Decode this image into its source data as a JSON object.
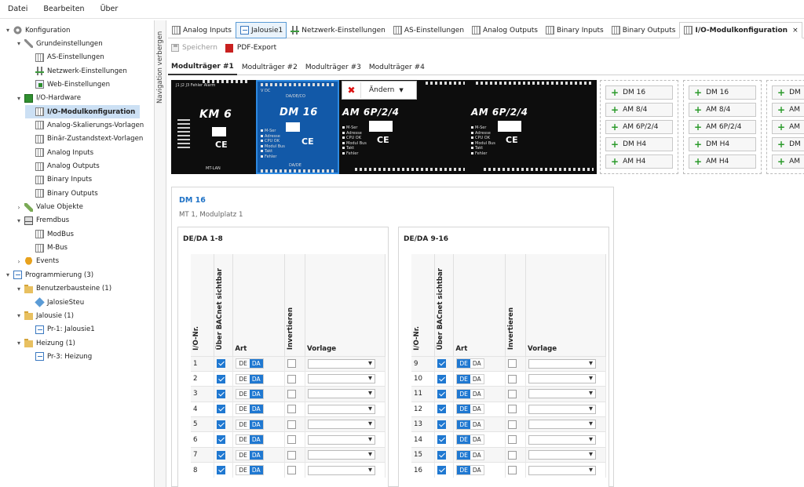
{
  "menu": [
    "Datei",
    "Bearbeiten",
    "Über"
  ],
  "tree": [
    {
      "label": "Konfiguration",
      "icon": "gear-icon",
      "chev": "▾"
    },
    {
      "label": "Grundeinstellungen",
      "icon": "wrench-icon",
      "chev": "▾"
    },
    {
      "label": "AS-Einstellungen",
      "icon": "grid-icon",
      "chev": ""
    },
    {
      "label": "Netzwerk-Einstellungen",
      "icon": "network-icon",
      "chev": ""
    },
    {
      "label": "Web-Einstellungen",
      "icon": "web-icon",
      "chev": ""
    },
    {
      "label": "I/O-Hardware",
      "icon": "hardware-icon",
      "chev": "▾"
    },
    {
      "label": "I/O-Modulkonfiguration",
      "icon": "grid-icon",
      "chev": ""
    },
    {
      "label": "Analog-Skalierungs-Vorlagen",
      "icon": "grid-icon",
      "chev": ""
    },
    {
      "label": "Binär-Zustandstext-Vorlagen",
      "icon": "grid-icon",
      "chev": ""
    },
    {
      "label": "Analog Inputs",
      "icon": "grid-icon",
      "chev": ""
    },
    {
      "label": "Analog Outputs",
      "icon": "grid-icon",
      "chev": ""
    },
    {
      "label": "Binary Inputs",
      "icon": "grid-icon",
      "chev": ""
    },
    {
      "label": "Binary Outputs",
      "icon": "grid-icon",
      "chev": ""
    },
    {
      "label": "Value Objekte",
      "icon": "value-icon",
      "chev": "›"
    },
    {
      "label": "Fremdbus",
      "icon": "bus-icon",
      "chev": "▾"
    },
    {
      "label": "ModBus",
      "icon": "grid-icon",
      "chev": ""
    },
    {
      "label": "M-Bus",
      "icon": "grid-icon",
      "chev": ""
    },
    {
      "label": "Events",
      "icon": "bell-icon",
      "chev": "›"
    },
    {
      "label": "Programmierung (3)",
      "icon": "program-icon",
      "chev": "▾"
    },
    {
      "label": "Benutzerbausteine (1)",
      "icon": "folder-icon",
      "chev": "▾"
    },
    {
      "label": "JalosieSteu",
      "icon": "cube-icon",
      "chev": ""
    },
    {
      "label": "Jalousie (1)",
      "icon": "folder-icon",
      "chev": "▾"
    },
    {
      "label": "Pr-1: Jalousie1",
      "icon": "program-icon",
      "chev": ""
    },
    {
      "label": "Heizung (1)",
      "icon": "folder-icon",
      "chev": "▾"
    },
    {
      "label": "Pr-3: Heizung",
      "icon": "program-icon",
      "chev": ""
    }
  ],
  "nav_toggle": "Navigation verbergen",
  "tabs": [
    "Analog Inputs",
    "Jalousie1",
    "Netzwerk-Einstellungen",
    "AS-Einstellungen",
    "Analog Outputs",
    "Binary Inputs",
    "Binary Outputs",
    "I/O-Modulkonfiguration"
  ],
  "tab_close": "×",
  "toolbar": {
    "save": "Speichern",
    "pdf": "PDF-Export"
  },
  "subtabs": [
    "Modulträger #1",
    "Modulträger #2",
    "Modulträger #3",
    "Modulträger #4"
  ],
  "modules": {
    "km6": {
      "name": "KM 6",
      "ce": "CE",
      "label": "MT-LAN"
    },
    "dm16": {
      "name": "DM 16",
      "sub": "DA/DE/CO",
      "bottom": "DA/DE",
      "ce": "CE",
      "leds": [
        "M-Ser",
        "Adresse",
        "CPU OK",
        "Modul Bus",
        "Takt",
        "Fehler"
      ]
    },
    "am1": {
      "name": "AM 6P/2/4",
      "ce": "CE",
      "leds": [
        "M-Ser",
        "Adresse",
        "CPU OK",
        "Modul Bus",
        "Takt",
        "Fehler"
      ]
    },
    "am2": {
      "name": "AM 6P/2/4",
      "ce": "CE",
      "leds": [
        "M-Ser",
        "Adresse",
        "CPU OK",
        "Modul Bus",
        "Takt",
        "Fehler"
      ]
    }
  },
  "popup": {
    "remove": "✖",
    "change": "Ändern",
    "arrow": "▼"
  },
  "add_buttons": [
    "DM 16",
    "AM 8/4",
    "AM 6P/2/4",
    "DM H4",
    "AM H4"
  ],
  "add_buttons_cut": [
    "DM",
    "AM",
    "AM",
    "DM",
    "AM"
  ],
  "detail": {
    "title": "DM 16",
    "subtitle": "MT 1, Modulplatz 1",
    "columns": [
      "I/O-Nr.",
      "Über BACnet sichtbar",
      "Art",
      "Invertieren",
      "Vorlage"
    ],
    "groups": [
      {
        "title": "DE/DA 1-8",
        "rows": [
          {
            "nr": "1",
            "de": "DE",
            "da": "DA",
            "active": "DA"
          },
          {
            "nr": "2",
            "de": "DE",
            "da": "DA",
            "active": "DA"
          },
          {
            "nr": "3",
            "de": "DE",
            "da": "DA",
            "active": "DA"
          },
          {
            "nr": "4",
            "de": "DE",
            "da": "DA",
            "active": "DA"
          },
          {
            "nr": "5",
            "de": "DE",
            "da": "DA",
            "active": "DA"
          },
          {
            "nr": "6",
            "de": "DE",
            "da": "DA",
            "active": "DA"
          },
          {
            "nr": "7",
            "de": "DE",
            "da": "DA",
            "active": "DA"
          },
          {
            "nr": "8",
            "de": "DE",
            "da": "DA",
            "active": "DA"
          }
        ]
      },
      {
        "title": "DE/DA 9-16",
        "rows": [
          {
            "nr": "9",
            "de": "DE",
            "da": "DA",
            "active": "DE"
          },
          {
            "nr": "10",
            "de": "DE",
            "da": "DA",
            "active": "DE"
          },
          {
            "nr": "11",
            "de": "DE",
            "da": "DA",
            "active": "DE"
          },
          {
            "nr": "12",
            "de": "DE",
            "da": "DA",
            "active": "DE"
          },
          {
            "nr": "13",
            "de": "DE",
            "da": "DA",
            "active": "DE"
          },
          {
            "nr": "14",
            "de": "DE",
            "da": "DA",
            "active": "DE"
          },
          {
            "nr": "15",
            "de": "DE",
            "da": "DA",
            "active": "DE"
          },
          {
            "nr": "16",
            "de": "DE",
            "da": "DA",
            "active": "DE"
          }
        ]
      }
    ]
  },
  "colors": {
    "accent": "#1f78d1",
    "selection": "#cce0f4",
    "add": "#2a9a2a"
  }
}
